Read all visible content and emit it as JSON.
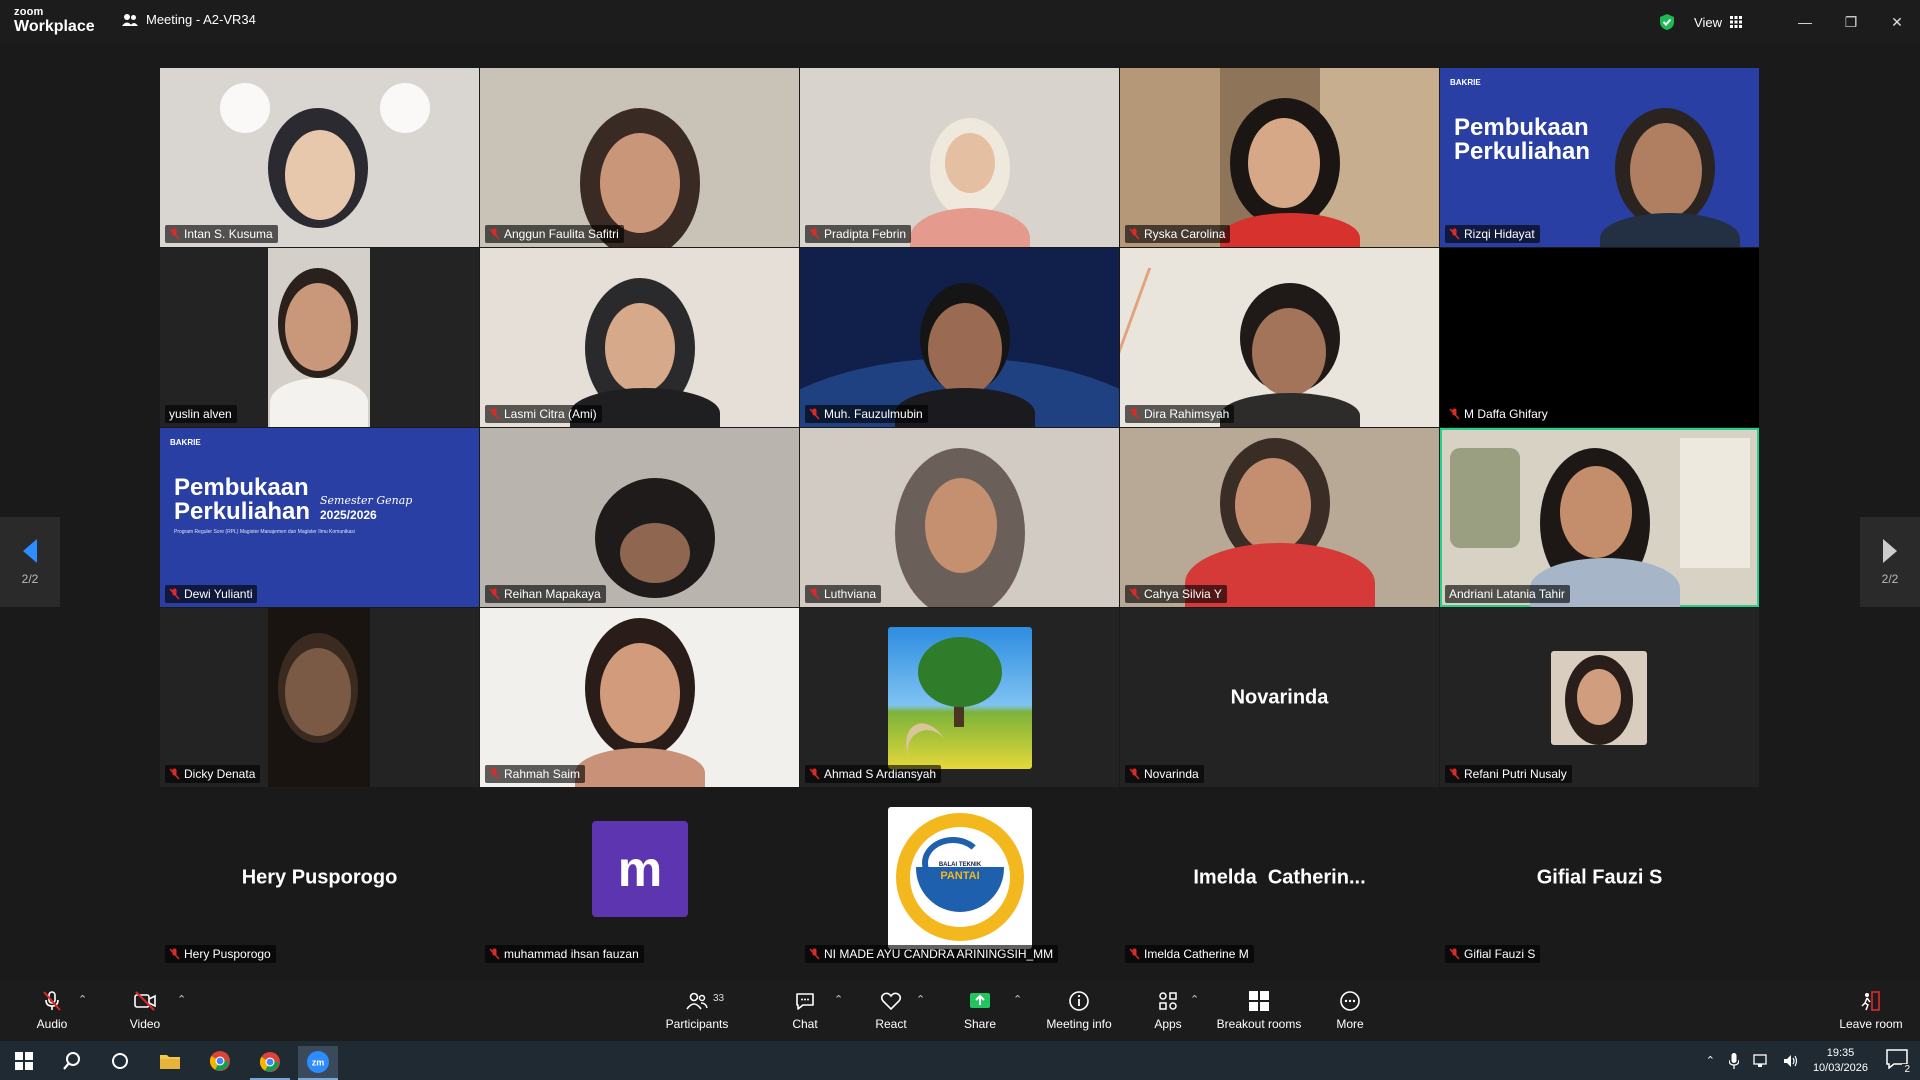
{
  "titlebar": {
    "brand_top": "zoom",
    "brand_bottom": "Workplace",
    "meeting_title": "Meeting - A2-VR34",
    "view_label": "View"
  },
  "participants": [
    {
      "name": "Intan S. Kusuma",
      "muted": true,
      "kind": "video"
    },
    {
      "name": "Anggun Faulita Safitri",
      "muted": true,
      "kind": "video"
    },
    {
      "name": "Pradipta Febrin",
      "muted": true,
      "kind": "video"
    },
    {
      "name": "Ryska Carolina",
      "muted": true,
      "kind": "video"
    },
    {
      "name": "Rizqi Hidayat",
      "muted": true,
      "kind": "slide-video"
    },
    {
      "name": "yuslin alven",
      "muted": false,
      "kind": "video"
    },
    {
      "name": "Lasmi Citra (Ami)",
      "muted": true,
      "kind": "video"
    },
    {
      "name": "Muh. Fauzulmubin",
      "muted": true,
      "kind": "video"
    },
    {
      "name": "Dira Rahimsyah",
      "muted": true,
      "kind": "video"
    },
    {
      "name": "M Daffa Ghifary",
      "muted": true,
      "kind": "black"
    },
    {
      "name": "Dewi Yulianti",
      "muted": true,
      "kind": "slide"
    },
    {
      "name": "Reihan Mapakaya",
      "muted": true,
      "kind": "video"
    },
    {
      "name": "Luthviana",
      "muted": true,
      "kind": "video"
    },
    {
      "name": "Cahya Silvia Y",
      "muted": true,
      "kind": "video"
    },
    {
      "name": "Andriani Latania Tahir",
      "muted": false,
      "kind": "video",
      "active": true
    },
    {
      "name": "Dicky Denata",
      "muted": true,
      "kind": "video"
    },
    {
      "name": "Rahmah Saim",
      "muted": true,
      "kind": "video"
    },
    {
      "name": "Ahmad S Ardiansyah",
      "muted": true,
      "kind": "picture-tree"
    },
    {
      "name": "Novarinda",
      "muted": true,
      "kind": "name",
      "display": "Novarinda"
    },
    {
      "name": "Refani Putri Nusaly",
      "muted": true,
      "kind": "picture-face"
    },
    {
      "name": "Hery Pusporogo",
      "muted": true,
      "kind": "name",
      "display": "Hery Pusporogo"
    },
    {
      "name": "muhammad ihsan fauzan",
      "muted": true,
      "kind": "avatar",
      "letter": "m"
    },
    {
      "name": "NI MADE AYU CANDRA ARININGSIH_MM",
      "muted": true,
      "kind": "picture-logo"
    },
    {
      "name": "Imelda Catherine M",
      "muted": true,
      "kind": "name",
      "display": "Imelda  Catherin..."
    },
    {
      "name": "Gifial Fauzi S",
      "muted": true,
      "kind": "name",
      "display": "Gifial Fauzi S"
    }
  ],
  "slides": {
    "brand": "BAKRIE",
    "title_line1": "Pembukaan",
    "title_line2": "Perkuliahan",
    "subtitle_script": "Semester Genap",
    "subtitle_year": "2025/2026",
    "subtitle_small": "Program Reguler Sore (RPL) Magister Manajemen dan Magister Ilmu Komunikasi"
  },
  "logo_text": {
    "line1": "BALAI TEKNIK",
    "line2": "PANTAI"
  },
  "pager": {
    "left": "2/2",
    "right": "2/2"
  },
  "toolbar": {
    "audio": "Audio",
    "video": "Video",
    "participants": "Participants",
    "participants_count": "33",
    "chat": "Chat",
    "react": "React",
    "share": "Share",
    "meeting_info": "Meeting info",
    "apps": "Apps",
    "breakout": "Breakout rooms",
    "more": "More",
    "leave": "Leave room"
  },
  "taskbar": {
    "time": "19:35",
    "date": "10/03/2026",
    "notif_count": "2"
  },
  "colors": {
    "active_border": "#23d18b",
    "muted_red": "#e02828",
    "share_green": "#22c55e",
    "avatar_purple": "#5e35b1"
  }
}
